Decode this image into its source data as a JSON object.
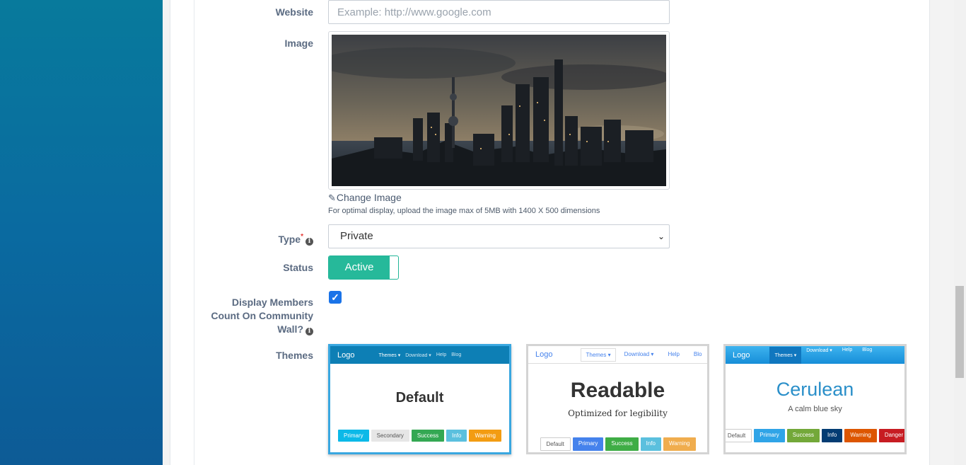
{
  "form": {
    "website": {
      "label": "Website",
      "placeholder": "Example: http://www.google.com"
    },
    "image": {
      "label": "Image",
      "change_label": "Change Image",
      "hint": "For optimal display, upload the image max of 5MB with 1400 X 500 dimensions"
    },
    "type": {
      "label": "Type",
      "required_mark": "*",
      "value": "Private"
    },
    "status": {
      "label": "Status",
      "value": "Active"
    },
    "display_members": {
      "label_line1": "Display Members",
      "label_line2": "Count On Community",
      "label_line3": "Wall?",
      "checked": true
    },
    "themes": {
      "label": "Themes"
    }
  },
  "themes": [
    {
      "name": "Default",
      "logo": "Logo",
      "nav": [
        "Themes ▾",
        "Download ▾",
        "Help",
        "Blog"
      ],
      "subtitle": "",
      "buttons": [
        "Primary",
        "Secondary",
        "Success",
        "Info",
        "Warning"
      ]
    },
    {
      "name": "Readable",
      "logo": "Logo",
      "nav": [
        "Themes ▾",
        "Download ▾",
        "Help",
        "Blo"
      ],
      "subtitle": "Optimized for legibility",
      "buttons": [
        "Default",
        "Primary",
        "Success",
        "Info",
        "Warning"
      ]
    },
    {
      "name": "Cerulean",
      "logo": "Logo",
      "nav": [
        "Themes ▾",
        "Download ▾",
        "Help",
        "Blog"
      ],
      "subtitle": "A calm blue sky",
      "buttons": [
        "Default",
        "Primary",
        "Success",
        "Info",
        "Warning",
        "Danger"
      ]
    }
  ],
  "colors": {
    "accent_teal": "#26b99a",
    "selected_border": "#39a7e0",
    "checkbox": "#1a73e8"
  }
}
